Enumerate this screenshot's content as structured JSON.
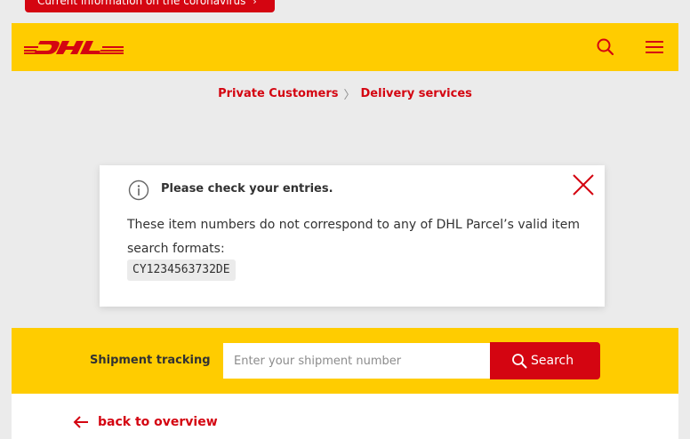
{
  "notice": {
    "text": "Current information on the coronavirus",
    "chevron": "›"
  },
  "header": {
    "logo_text": "DHL",
    "search_icon": "search-icon",
    "menu_icon": "hamburger-menu-icon",
    "brand_yellow": "#ffcc00",
    "brand_red": "#d40511"
  },
  "breadcrumb": {
    "items": [
      "Private Customers",
      "Delivery services"
    ],
    "separator": "〉"
  },
  "dialog": {
    "title": "Please check your entries.",
    "message": "These item numbers do not correspond to any of DHL Parcel’s valid item search formats:",
    "codes": [
      "CY1234563732DE"
    ],
    "info_icon": "info-icon",
    "close_icon": "close-icon"
  },
  "tracking": {
    "label": "Shipment tracking",
    "input_placeholder": "Enter your shipment number",
    "input_value": "",
    "button_label": "Search"
  },
  "back": {
    "label": "back to overview",
    "icon": "arrow-left-icon"
  }
}
